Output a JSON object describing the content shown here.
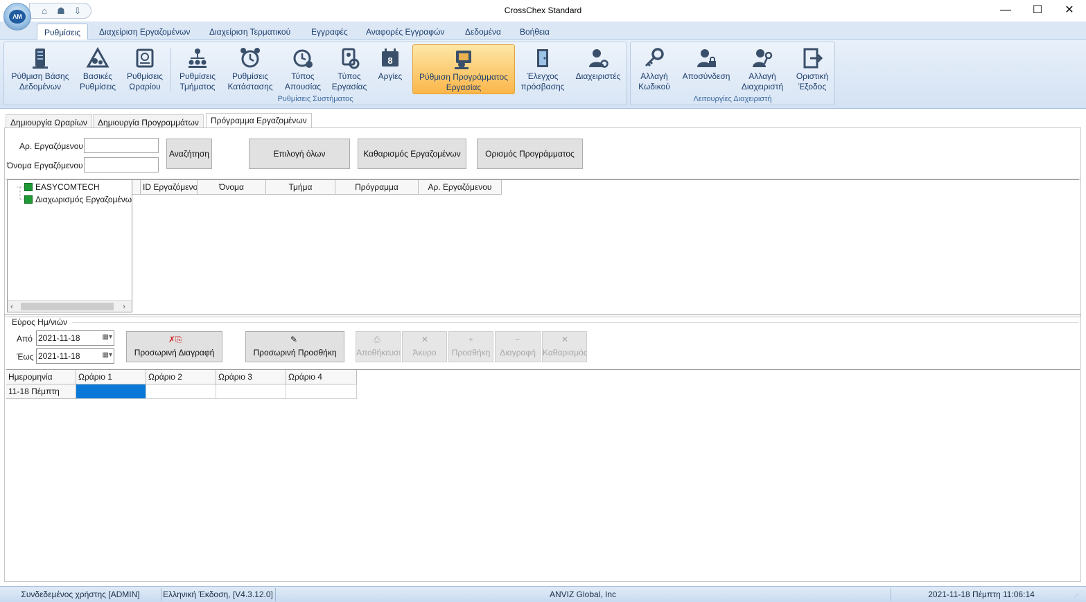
{
  "window": {
    "title": "CrossChex Standard",
    "minimize": "—",
    "maximize": "☐",
    "close": "✕"
  },
  "ribbon_tabs": [
    {
      "label": "Ρυθμίσεις",
      "active": true
    },
    {
      "label": "Διαχείριση Εργαζομένων"
    },
    {
      "label": "Διαχείριση Τερματικού"
    },
    {
      "label": "Εγγραφές"
    },
    {
      "label": "Αναφορές Εγγραφών"
    },
    {
      "label": "Δεδομένα"
    },
    {
      "label": "Βοήθεια"
    }
  ],
  "ribbon": {
    "group_system": {
      "label": "Ρυθμίσεις Συστήματος",
      "buttons": [
        {
          "line1": "Ρύθμιση Βάσης",
          "line2": "Δεδομένων",
          "icon": "database-server-icon"
        },
        {
          "line1": "Βασικές",
          "line2": "Ρυθμίσεις",
          "icon": "basic-settings-icon"
        },
        {
          "line1": "Ρυθμίσεις",
          "line2": "Ωραρίου",
          "icon": "timetable-settings-icon"
        },
        {
          "line1": "Ρυθμίσεις",
          "line2": "Τμήματος",
          "icon": "department-tree-icon"
        },
        {
          "line1": "Ρυθμίσεις",
          "line2": "Κατάστασης",
          "icon": "alarm-clock-icon"
        },
        {
          "line1": "Τύπος",
          "line2": "Απουσίας",
          "icon": "absence-clock-icon"
        },
        {
          "line1": "Τύπος",
          "line2": "Εργασίας",
          "icon": "work-type-icon"
        },
        {
          "line1": "Αργίες",
          "line2": "",
          "icon": "holiday-calendar-icon"
        },
        {
          "line1": "Ρύθμιση Προγράμματος",
          "line2": "Εργασίας",
          "icon": "schedule-setup-icon",
          "active": true
        },
        {
          "line1": "Έλεγχος",
          "line2": "πρόσβασης",
          "icon": "access-door-icon"
        },
        {
          "line1": "Διαχειριστές",
          "line2": "",
          "icon": "administrators-icon"
        }
      ]
    },
    "group_admin": {
      "label": "Λειτουργίες Διαχειριστή",
      "buttons": [
        {
          "line1": "Αλλαγή",
          "line2": "Κωδικού",
          "icon": "key-icon"
        },
        {
          "line1": "Αποσύνδεση",
          "line2": "",
          "icon": "logout-user-lock-icon"
        },
        {
          "line1": "Αλλαγή",
          "line2": "Διαχειριστή",
          "icon": "change-admin-key-icon"
        },
        {
          "line1": "Οριστική",
          "line2": "Έξοδος",
          "icon": "exit-door-icon"
        }
      ]
    }
  },
  "content_tabs": [
    {
      "label": "Δημιουργία Ωραρίων"
    },
    {
      "label": "Δημιουργία Προγραμμάτων"
    },
    {
      "label": "Πρόγραμμα Εργαζομένων",
      "active": true
    }
  ],
  "filter": {
    "emp_no_label": "Αρ. Εργαζόμενου",
    "emp_no_value": "",
    "emp_name_label": "Όνομα Εργαζόμενου",
    "emp_name_value": "",
    "search_label": "Αναζήτηση",
    "select_all_label": "Επιλογή όλων",
    "clear_employees_label": "Καθαρισμός Εργαζομένων",
    "set_schedule_label": "Ορισμός Προγράμματος"
  },
  "tree": {
    "nodes": [
      {
        "label": "EASYCOMTECH"
      },
      {
        "label": "Διαχωρισμός Εργαζομένω"
      }
    ]
  },
  "employee_grid": {
    "columns": [
      "ID Εργαζόμενο",
      "Όνομα",
      "Τμήμα",
      "Πρόγραμμα",
      "Αρ. Εργαζόμενου"
    ]
  },
  "date_range": {
    "title": "Εύρος Ημ/νιών",
    "from_label": "Από",
    "from_value": "2021-11-18",
    "to_label": "Έως",
    "to_value": "2021-11-18"
  },
  "actions": {
    "temp_delete": "Προσωρινή Διαγραφή",
    "temp_add": "Προσωρινή Προσθήκη",
    "save": "Αποθήκευση",
    "cancel": "Άκυρο",
    "add": "Προσθήκη",
    "delete": "Διαγραφή",
    "clear": "Καθαρισμός"
  },
  "schedule_grid": {
    "columns": [
      "Ημερομηνία",
      "Ωράριο 1",
      "Ωράριο 2",
      "Ωράριο 3",
      "Ωράριο 4"
    ],
    "rows": [
      {
        "date": "11-18 Πέμπτη",
        "t1": "",
        "t2": "",
        "t3": "",
        "t4": ""
      }
    ]
  },
  "statusbar": {
    "user": "Συνδεδεμένος χρήστης [ADMIN]",
    "version": "Ελληνική Έκδοση, [V4.3.12.0]",
    "company": "ANVIZ Global, Inc",
    "datetime": "2021-11-18 Πέμπτη 11:06:14"
  },
  "colors": {
    "ribbon_blue": "#dbe7f5",
    "active_orange": "#fbb64a",
    "selection_blue": "#0a78d7",
    "tree_green": "#1d9a35"
  }
}
